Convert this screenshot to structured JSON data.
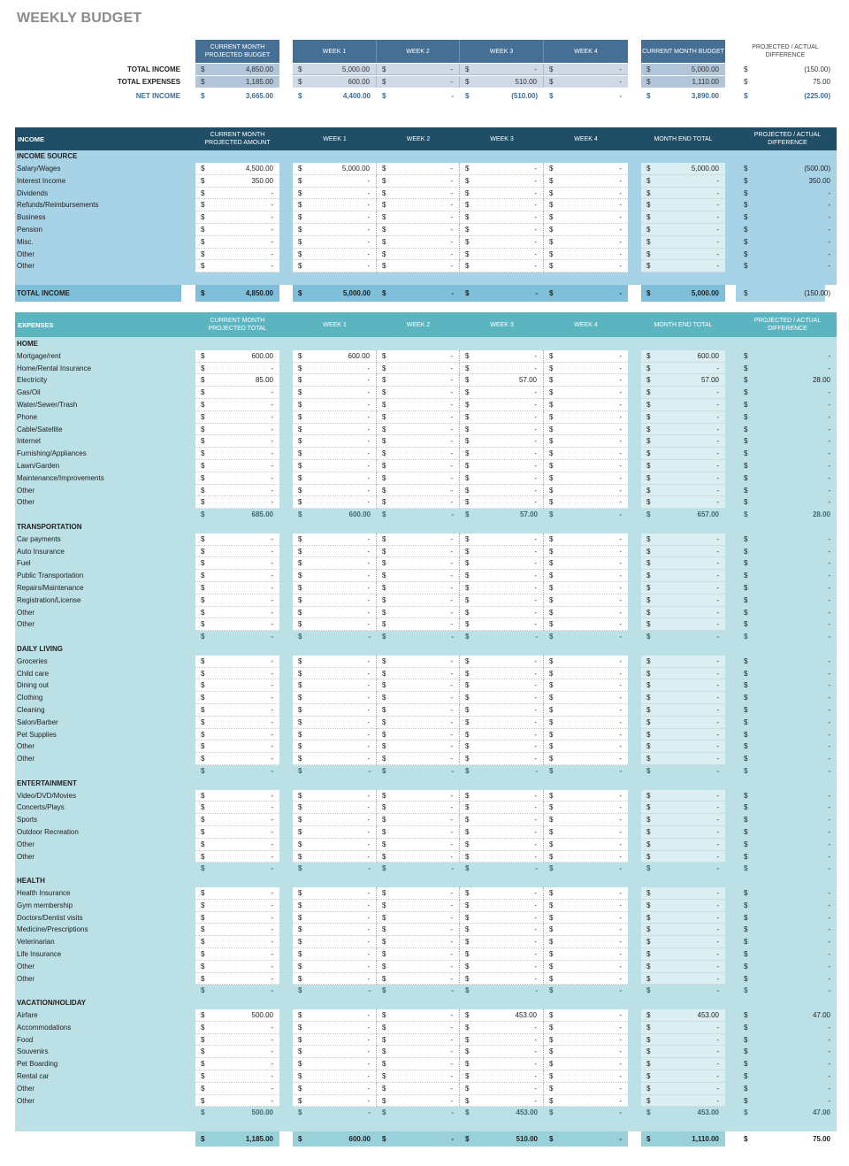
{
  "title": "WEEKLY BUDGET",
  "summary": {
    "headers": [
      "CURRENT MONTH PROJECTED BUDGET",
      "WEEK 1",
      "WEEK 2",
      "WEEK 3",
      "WEEK 4",
      "CURRENT MONTH BUDGET",
      "PROJECTED / ACTUAL DIFFERENCE"
    ],
    "rows": [
      {
        "label": "TOTAL INCOME",
        "values": [
          "4,850.00",
          "5,000.00",
          "-",
          "-",
          "-",
          "5,000.00",
          "(150.00)"
        ]
      },
      {
        "label": "TOTAL EXPENSES",
        "values": [
          "1,185.00",
          "600.00",
          "-",
          "510.00",
          "-",
          "1,110.00",
          "75.00"
        ]
      },
      {
        "label": "NET INCOME",
        "values": [
          "3,665.00",
          "4,400.00",
          "-",
          "(510.00)",
          "-",
          "3,890.00",
          "(225.00)"
        ]
      }
    ]
  },
  "currency": "$",
  "income": {
    "header_label": "INCOME",
    "headers": [
      "CURRENT MONTH PROJECTED AMOUNT",
      "WEEK 1",
      "WEEK 2",
      "WEEK 3",
      "WEEK 4",
      "MONTH END TOTAL",
      "PROJECTED / ACTUAL DIFFERENCE"
    ],
    "section_label": "INCOME SOURCE",
    "rows": [
      {
        "label": "Salary/Wages",
        "values": [
          "4,500.00",
          "5,000.00",
          "-",
          "-",
          "-",
          "5,000.00",
          "(500.00)"
        ]
      },
      {
        "label": "Interest Income",
        "values": [
          "350.00",
          "-",
          "-",
          "-",
          "-",
          "-",
          "350.00"
        ]
      },
      {
        "label": "Dividends",
        "values": [
          "-",
          "-",
          "-",
          "-",
          "-",
          "-",
          "-"
        ]
      },
      {
        "label": "Refunds/Reimbursements",
        "values": [
          "-",
          "-",
          "-",
          "-",
          "-",
          "-",
          "-"
        ]
      },
      {
        "label": "Business",
        "values": [
          "-",
          "-",
          "-",
          "-",
          "-",
          "-",
          "-"
        ]
      },
      {
        "label": "Pension",
        "values": [
          "-",
          "-",
          "-",
          "-",
          "-",
          "-",
          "-"
        ]
      },
      {
        "label": "Misc.",
        "values": [
          "-",
          "-",
          "-",
          "-",
          "-",
          "-",
          "-"
        ]
      },
      {
        "label": "Other",
        "values": [
          "-",
          "-",
          "-",
          "-",
          "-",
          "-",
          "-"
        ]
      },
      {
        "label": "Other",
        "values": [
          "-",
          "-",
          "-",
          "-",
          "-",
          "-",
          "-"
        ]
      }
    ],
    "total": {
      "label": "TOTAL INCOME",
      "values": [
        "4,850.00",
        "5,000.00",
        "-",
        "-",
        "-",
        "5,000.00",
        "(150.00)"
      ]
    }
  },
  "expenses": {
    "header_label": "EXPENSES",
    "headers": [
      "CURRENT MONTH PROJECTED TOTAL",
      "WEEK 1",
      "WEEK 2",
      "WEEK 3",
      "WEEK 4",
      "MONTH END TOTAL",
      "PROJECTED / ACTUAL DIFFERENCE"
    ],
    "sections": [
      {
        "label": "HOME",
        "rows": [
          {
            "label": "Mortgage/rent",
            "values": [
              "600.00",
              "600.00",
              "-",
              "-",
              "-",
              "600.00",
              "-"
            ]
          },
          {
            "label": "Home/Rental Insurance",
            "values": [
              "-",
              "-",
              "-",
              "-",
              "-",
              "-",
              "-"
            ]
          },
          {
            "label": "Electricity",
            "values": [
              "85.00",
              "-",
              "-",
              "57.00",
              "-",
              "57.00",
              "28.00"
            ]
          },
          {
            "label": "Gas/Oil",
            "values": [
              "-",
              "-",
              "-",
              "-",
              "-",
              "-",
              "-"
            ]
          },
          {
            "label": "Water/Sewer/Trash",
            "values": [
              "-",
              "-",
              "-",
              "-",
              "-",
              "-",
              "-"
            ]
          },
          {
            "label": "Phone",
            "values": [
              "-",
              "-",
              "-",
              "-",
              "-",
              "-",
              "-"
            ]
          },
          {
            "label": "Cable/Satellite",
            "values": [
              "-",
              "-",
              "-",
              "-",
              "-",
              "-",
              "-"
            ]
          },
          {
            "label": "Internet",
            "values": [
              "-",
              "-",
              "-",
              "-",
              "-",
              "-",
              "-"
            ]
          },
          {
            "label": "Furnishing/Appliances",
            "values": [
              "-",
              "-",
              "-",
              "-",
              "-",
              "-",
              "-"
            ]
          },
          {
            "label": "Lawn/Garden",
            "values": [
              "-",
              "-",
              "-",
              "-",
              "-",
              "-",
              "-"
            ]
          },
          {
            "label": "Maintenance/Improvements",
            "values": [
              "-",
              "-",
              "-",
              "-",
              "-",
              "-",
              "-"
            ]
          },
          {
            "label": "Other",
            "values": [
              "-",
              "-",
              "-",
              "-",
              "-",
              "-",
              "-"
            ]
          },
          {
            "label": "Other",
            "values": [
              "-",
              "-",
              "-",
              "-",
              "-",
              "-",
              "-"
            ]
          }
        ],
        "subtotal": [
          "685.00",
          "600.00",
          "-",
          "57.00",
          "-",
          "657.00",
          "28.00"
        ]
      },
      {
        "label": "TRANSPORTATION",
        "rows": [
          {
            "label": "Car payments",
            "values": [
              "-",
              "-",
              "-",
              "-",
              "-",
              "-",
              "-"
            ]
          },
          {
            "label": "Auto Insurance",
            "values": [
              "-",
              "-",
              "-",
              "-",
              "-",
              "-",
              "-"
            ]
          },
          {
            "label": "Fuel",
            "values": [
              "-",
              "-",
              "-",
              "-",
              "-",
              "-",
              "-"
            ]
          },
          {
            "label": "Public Transportation",
            "values": [
              "-",
              "-",
              "-",
              "-",
              "-",
              "-",
              "-"
            ]
          },
          {
            "label": "Repairs/Maintenance",
            "values": [
              "-",
              "-",
              "-",
              "-",
              "-",
              "-",
              "-"
            ]
          },
          {
            "label": "Registration/License",
            "values": [
              "-",
              "-",
              "-",
              "-",
              "-",
              "-",
              "-"
            ]
          },
          {
            "label": "Other",
            "values": [
              "-",
              "-",
              "-",
              "-",
              "-",
              "-",
              "-"
            ]
          },
          {
            "label": "Other",
            "values": [
              "-",
              "-",
              "-",
              "-",
              "-",
              "-",
              "-"
            ]
          }
        ],
        "subtotal": [
          "-",
          "-",
          "-",
          "-",
          "-",
          "-",
          "-"
        ]
      },
      {
        "label": "DAILY LIVING",
        "rows": [
          {
            "label": "Groceries",
            "values": [
              "-",
              "-",
              "-",
              "-",
              "-",
              "-",
              "-"
            ]
          },
          {
            "label": "Child care",
            "values": [
              "-",
              "-",
              "-",
              "-",
              "-",
              "-",
              "-"
            ]
          },
          {
            "label": "Dining out",
            "values": [
              "-",
              "-",
              "-",
              "-",
              "-",
              "-",
              "-"
            ]
          },
          {
            "label": "Clothing",
            "values": [
              "-",
              "-",
              "-",
              "-",
              "-",
              "-",
              "-"
            ]
          },
          {
            "label": "Cleaning",
            "values": [
              "-",
              "-",
              "-",
              "-",
              "-",
              "-",
              "-"
            ]
          },
          {
            "label": "Salon/Barber",
            "values": [
              "-",
              "-",
              "-",
              "-",
              "-",
              "-",
              "-"
            ]
          },
          {
            "label": "Pet Supplies",
            "values": [
              "-",
              "-",
              "-",
              "-",
              "-",
              "-",
              "-"
            ]
          },
          {
            "label": "Other",
            "values": [
              "-",
              "-",
              "-",
              "-",
              "-",
              "-",
              "-"
            ]
          },
          {
            "label": "Other",
            "values": [
              "-",
              "-",
              "-",
              "-",
              "-",
              "-",
              "-"
            ]
          }
        ],
        "subtotal": [
          "-",
          "-",
          "-",
          "-",
          "-",
          "-",
          "-"
        ]
      },
      {
        "label": "ENTERTAINMENT",
        "rows": [
          {
            "label": "Video/DVD/Movies",
            "values": [
              "-",
              "-",
              "-",
              "-",
              "-",
              "-",
              "-"
            ]
          },
          {
            "label": "Concerts/Plays",
            "values": [
              "-",
              "-",
              "-",
              "-",
              "-",
              "-",
              "-"
            ]
          },
          {
            "label": "Sports",
            "values": [
              "-",
              "-",
              "-",
              "-",
              "-",
              "-",
              "-"
            ]
          },
          {
            "label": "Outdoor Recreation",
            "values": [
              "-",
              "-",
              "-",
              "-",
              "-",
              "-",
              "-"
            ]
          },
          {
            "label": "Other",
            "values": [
              "-",
              "-",
              "-",
              "-",
              "-",
              "-",
              "-"
            ]
          },
          {
            "label": "Other",
            "values": [
              "-",
              "-",
              "-",
              "-",
              "-",
              "-",
              "-"
            ]
          }
        ],
        "subtotal": [
          "-",
          "-",
          "-",
          "-",
          "-",
          "-",
          "-"
        ]
      },
      {
        "label": "HEALTH",
        "rows": [
          {
            "label": "Health Insurance",
            "values": [
              "-",
              "-",
              "-",
              "-",
              "-",
              "-",
              "-"
            ]
          },
          {
            "label": "Gym membership",
            "values": [
              "-",
              "-",
              "-",
              "-",
              "-",
              "-",
              "-"
            ]
          },
          {
            "label": "Doctors/Dentist visits",
            "values": [
              "-",
              "-",
              "-",
              "-",
              "-",
              "-",
              "-"
            ]
          },
          {
            "label": "Medicine/Prescriptions",
            "values": [
              "-",
              "-",
              "-",
              "-",
              "-",
              "-",
              "-"
            ]
          },
          {
            "label": "Veterinarian",
            "values": [
              "-",
              "-",
              "-",
              "-",
              "-",
              "-",
              "-"
            ]
          },
          {
            "label": "Life Insurance",
            "values": [
              "-",
              "-",
              "-",
              "-",
              "-",
              "-",
              "-"
            ]
          },
          {
            "label": "Other",
            "values": [
              "-",
              "-",
              "-",
              "-",
              "-",
              "-",
              "-"
            ]
          },
          {
            "label": "Other",
            "values": [
              "-",
              "-",
              "-",
              "-",
              "-",
              "-",
              "-"
            ]
          }
        ],
        "subtotal": [
          "-",
          "-",
          "-",
          "-",
          "-",
          "-",
          "-"
        ]
      },
      {
        "label": "VACATION/HOLIDAY",
        "rows": [
          {
            "label": "Airfare",
            "values": [
              "500.00",
              "-",
              "-",
              "453.00",
              "-",
              "453.00",
              "47.00"
            ]
          },
          {
            "label": "Accommodations",
            "values": [
              "-",
              "-",
              "-",
              "-",
              "-",
              "-",
              "-"
            ]
          },
          {
            "label": "Food",
            "values": [
              "-",
              "-",
              "-",
              "-",
              "-",
              "-",
              "-"
            ]
          },
          {
            "label": "Souvenirs",
            "values": [
              "-",
              "-",
              "-",
              "-",
              "-",
              "-",
              "-"
            ]
          },
          {
            "label": "Pet Boarding",
            "values": [
              "-",
              "-",
              "-",
              "-",
              "-",
              "-",
              "-"
            ]
          },
          {
            "label": "Rental car",
            "values": [
              "-",
              "-",
              "-",
              "-",
              "-",
              "-",
              "-"
            ]
          },
          {
            "label": "Other",
            "values": [
              "-",
              "-",
              "-",
              "-",
              "-",
              "-",
              "-"
            ]
          },
          {
            "label": "Other",
            "values": [
              "-",
              "-",
              "-",
              "-",
              "-",
              "-",
              "-"
            ]
          }
        ],
        "subtotal": [
          "500.00",
          "-",
          "-",
          "453.00",
          "-",
          "453.00",
          "47.00"
        ]
      }
    ],
    "total": [
      "1,185.00",
      "600.00",
      "-",
      "510.00",
      "-",
      "1,110.00",
      "75.00"
    ]
  },
  "colors": {
    "title": "#8a8a8a",
    "summary_header": "#456f95",
    "summary_cell": "#cfdae6",
    "summary_month": "#b3c5d8",
    "net_income": "#3c6d9a",
    "income_header": "#1f4e66",
    "income_bg": "#a8d2e5",
    "income_total": "#7fbfda",
    "expense_header": "#5ab5c1",
    "expense_bg": "#bbe0e5",
    "expense_total": "#99d1da",
    "month_end_cell": "#dbeff3"
  }
}
